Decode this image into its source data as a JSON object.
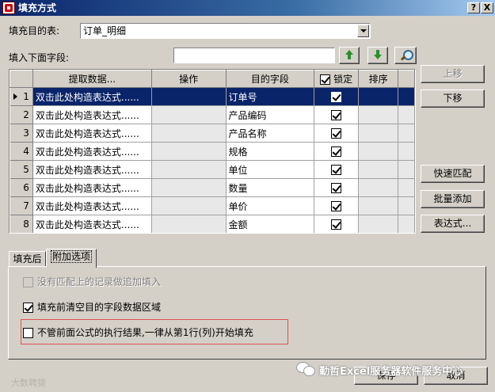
{
  "window": {
    "title": "填充方式",
    "help_label": "?",
    "close_label": "X"
  },
  "fill_target": {
    "label": "填充目的表:",
    "value": "订单_明细"
  },
  "field_filter": {
    "label": "填入下面字段:",
    "value": ""
  },
  "table": {
    "columns": [
      "提取数据...",
      "操作",
      "目的字段",
      "锁定",
      "排序"
    ],
    "header_lock_checked": true,
    "rows": [
      {
        "num": "1",
        "expr": "双击此处构造表达式......",
        "op": "",
        "field": "订单号",
        "locked": true,
        "sort": "",
        "selected": true
      },
      {
        "num": "2",
        "expr": "双击此处构造表达式......",
        "op": "",
        "field": "产品编码",
        "locked": true,
        "sort": "",
        "selected": false
      },
      {
        "num": "3",
        "expr": "双击此处构造表达式......",
        "op": "",
        "field": "产品名称",
        "locked": true,
        "sort": "",
        "selected": false
      },
      {
        "num": "4",
        "expr": "双击此处构造表达式......",
        "op": "",
        "field": "规格",
        "locked": true,
        "sort": "",
        "selected": false
      },
      {
        "num": "5",
        "expr": "双击此处构造表达式......",
        "op": "",
        "field": "单位",
        "locked": true,
        "sort": "",
        "selected": false
      },
      {
        "num": "6",
        "expr": "双击此处构造表达式......",
        "op": "",
        "field": "数量",
        "locked": true,
        "sort": "",
        "selected": false
      },
      {
        "num": "7",
        "expr": "双击此处构造表达式......",
        "op": "",
        "field": "单价",
        "locked": true,
        "sort": "",
        "selected": false
      },
      {
        "num": "8",
        "expr": "双击此处构造表达式......",
        "op": "",
        "field": "金额",
        "locked": true,
        "sort": "",
        "selected": false
      }
    ]
  },
  "side_buttons": {
    "move_up": "上移",
    "move_down": "下移",
    "quick_match": "快速匹配",
    "batch_add": "批量添加",
    "expression": "表达式..."
  },
  "tabs": {
    "after_fill": "填充后",
    "extra_options": "附加选项"
  },
  "options": [
    {
      "label": "没有匹配上的记录做追加填入",
      "checked": false,
      "enabled": false
    },
    {
      "label": "填充前清空目的字段数据区域",
      "checked": true,
      "enabled": true
    },
    {
      "label": "不管前面公式的执行结果,一律从第1行(列)开始填充",
      "checked": false,
      "enabled": true
    }
  ],
  "footer": {
    "save": "保存",
    "cancel": "取消"
  },
  "watermarks": {
    "right": "勤哲Excel服务器软件服务中心",
    "left": "大数聘猿"
  },
  "icons": {
    "move_up_green": "arrow-up-icon",
    "move_down_green": "arrow-down-icon",
    "search": "search-icon",
    "lock_checkbox": "checkbox-icon"
  },
  "colors": {
    "selection": "#0a246a",
    "highlight_border": "#e05050",
    "arrow_green": "#2a8f2a"
  }
}
